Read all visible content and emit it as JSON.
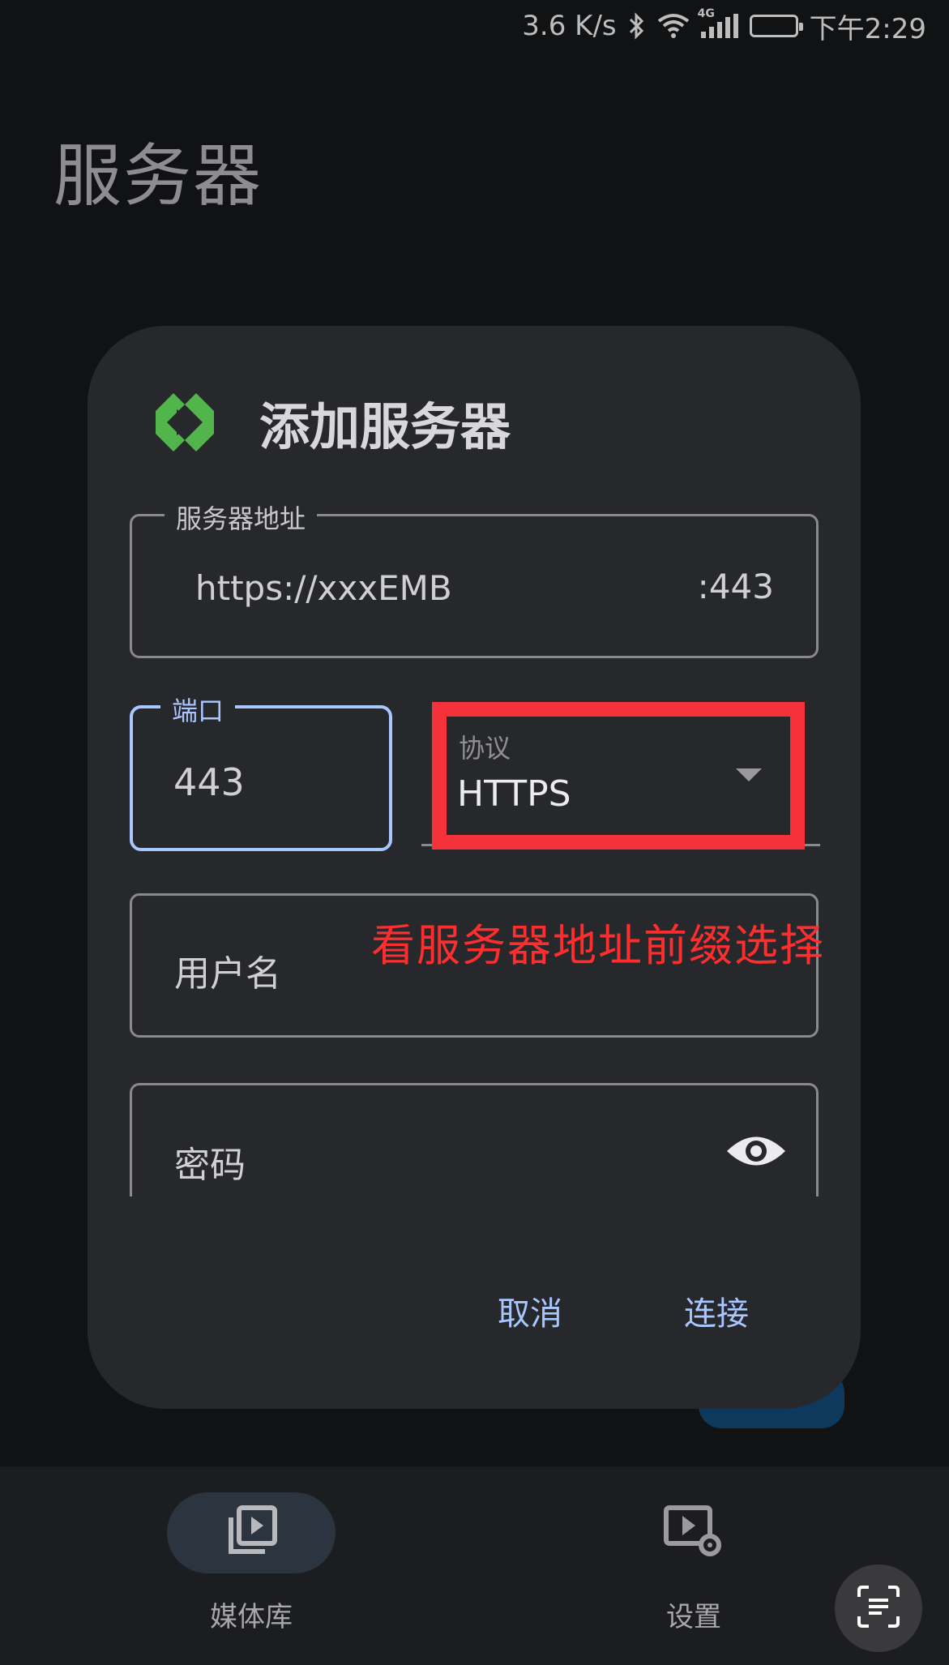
{
  "status_bar": {
    "net_speed": "3.6 K/s",
    "network_type": "4G",
    "time": "下午2:29",
    "icons": [
      "bluetooth-icon",
      "wifi-icon",
      "signal-icon",
      "battery-icon"
    ]
  },
  "page": {
    "title": "服务器"
  },
  "dialog": {
    "logo_icon": "emby-logo-icon",
    "title": "添加服务器",
    "server_address": {
      "label": "服务器地址",
      "value": "https://xxxEMB",
      "suffix": ":443"
    },
    "port": {
      "label": "端口",
      "value": "443"
    },
    "protocol": {
      "label": "协议",
      "value": "HTTPS"
    },
    "username": {
      "placeholder": "用户名"
    },
    "password": {
      "placeholder": "密码",
      "toggle_icon": "eye-icon"
    },
    "cancel_label": "取消",
    "connect_label": "连接"
  },
  "annotation": {
    "text": "看服务器地址前缀选择",
    "color": "#ff2e2e"
  },
  "bottom_nav": {
    "items": [
      {
        "label": "媒体库",
        "icon": "media-library-icon",
        "active": true
      },
      {
        "label": "设置",
        "icon": "settings-icon",
        "active": false
      }
    ]
  },
  "colors": {
    "accent": "#a9c7ff",
    "highlight_box": "#f5313a",
    "logo": "#52b54b"
  }
}
